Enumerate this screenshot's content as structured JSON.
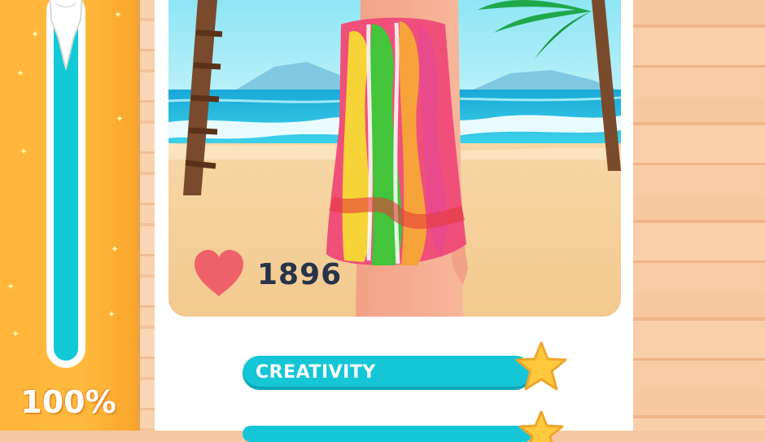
{
  "meter": {
    "percent_label": "100%",
    "fill_fraction": 1.0
  },
  "post": {
    "likes": "1896"
  },
  "ratings": [
    {
      "label": "CREATIVITY",
      "fill_fraction": 1.0
    }
  ],
  "colors": {
    "accent": "#15c6d6",
    "panel": "#ffb53a",
    "heart": "#f0626a",
    "star": "#ffc93d"
  }
}
